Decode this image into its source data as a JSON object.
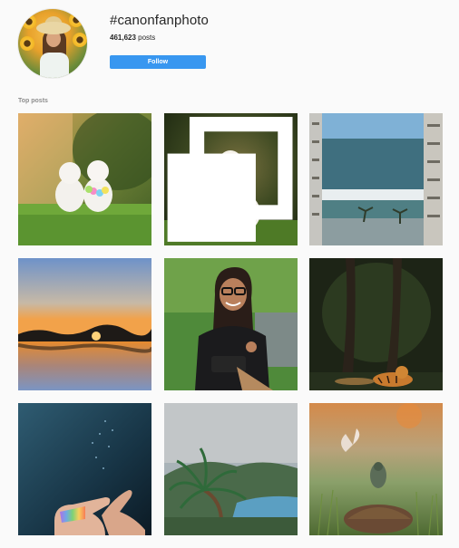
{
  "header": {
    "hashtag": "#canonfanphoto",
    "post_count": "461,623",
    "post_count_suffix": " posts",
    "follow_label": "Follow"
  },
  "section": {
    "label": "Top posts"
  },
  "posts": [
    {
      "subject": "two-dogs-garden",
      "multiple": false
    },
    {
      "subject": "two-dogs-stacked",
      "multiple": true
    },
    {
      "subject": "ocean-balcony",
      "multiple": false
    },
    {
      "subject": "sunset-lake",
      "multiple": false
    },
    {
      "subject": "woman-camera",
      "multiple": false
    },
    {
      "subject": "tiger-forest",
      "multiple": false
    },
    {
      "subject": "hands-light",
      "multiple": false
    },
    {
      "subject": "palm-coast",
      "multiple": false
    },
    {
      "subject": "butterfly-turtle",
      "multiple": false
    }
  ],
  "colors": {
    "accent": "#3897f0",
    "background": "#fafafa",
    "text": "#262626",
    "muted": "#8e8e8e"
  }
}
